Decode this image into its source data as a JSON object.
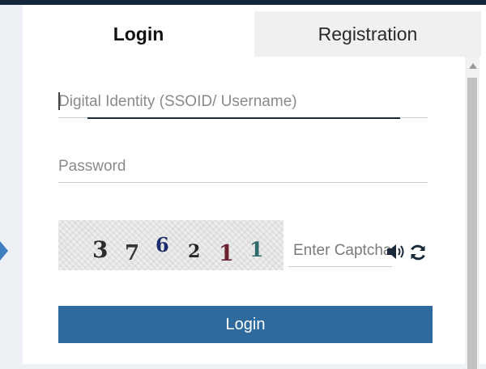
{
  "tabs": {
    "login_label": "Login",
    "registration_label": "Registration"
  },
  "form": {
    "ssoid_placeholder": "Digital Identity (SSOID/ Username)",
    "password_placeholder": "Password",
    "captcha_placeholder": "Enter Captcha",
    "login_button_label": "Login"
  },
  "captcha": {
    "digits": [
      "3",
      "7",
      "6",
      "2",
      "1",
      "1"
    ],
    "digit_colors": [
      "#2b2b2b",
      "#343434",
      "#1c2a6e",
      "#262626",
      "#6a2233",
      "#2e6c6c"
    ]
  },
  "icons": {
    "audio": "speaker-icon",
    "refresh": "refresh-icon"
  },
  "colors": {
    "accent": "#2e6a9e",
    "header": "#14263a"
  }
}
